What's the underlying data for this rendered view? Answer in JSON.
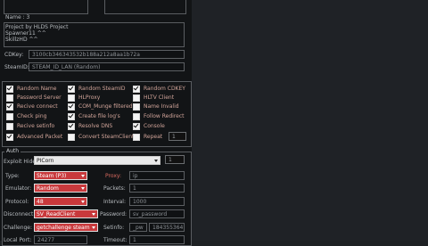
{
  "info": {
    "name_line": "Name : 3",
    "desc_lines": [
      "Project by HLDS Project",
      "Spawner11 ^^",
      "SkillzHD ^^"
    ],
    "cdkey_label": "CDKey:",
    "cdkey_value": "3100cb346343532b188a212a8aa1b72a",
    "steamid_label": "SteamID:",
    "steamid_value": "STEAM_ID_LAN (Random)"
  },
  "options": {
    "col1": [
      {
        "label": "Random Name",
        "checked": true
      },
      {
        "label": "Password Server",
        "checked": false
      },
      {
        "label": "Recive connect",
        "checked": true
      },
      {
        "label": "Check ping",
        "checked": false
      },
      {
        "label": "Recive setinfo",
        "checked": false
      },
      {
        "label": "Advanced Packet",
        "checked": true
      }
    ],
    "col2": [
      {
        "label": "Random SteamID",
        "checked": true
      },
      {
        "label": "HLProxy",
        "checked": false
      },
      {
        "label": "COM_Munge filtered",
        "checked": true
      },
      {
        "label": "Create file log's",
        "checked": true
      },
      {
        "label": "Resolve DNS",
        "checked": true
      },
      {
        "label": "Convert SteamClient",
        "checked": false
      }
    ],
    "col3": [
      {
        "label": "Random CDKEY",
        "checked": true
      },
      {
        "label": "HLTV Client",
        "checked": false
      },
      {
        "label": "Name Invalid",
        "checked": false
      },
      {
        "label": "Follow Redirect",
        "checked": false
      },
      {
        "label": "Console",
        "checked": true
      },
      {
        "label": "Repeat",
        "checked": false
      }
    ],
    "repeat_value": "1"
  },
  "auth": {
    "group_title": "Auth",
    "exploit_label": "Exploit Hide:",
    "exploit_value": "PICorn",
    "exploit_count": "1",
    "type_label": "Type:",
    "type_value": "Steam (P3)",
    "emulator_label": "Emulator:",
    "emulator_value": "Random",
    "protocol_label": "Protocol:",
    "protocol_value": "48",
    "disconnect_label": "Disconnect:",
    "disconnect_value": "SV_ReadClient",
    "challenge_label": "Challenge:",
    "challenge_value": "getchallenge steam",
    "localport_label": "Local Port:",
    "localport_value": "24277",
    "proxy_label": "Proxy:",
    "proxy_value": "ip",
    "packets_label": "Packets:",
    "packets_value": "1",
    "interval_label": "Interval:",
    "interval_value": "1000",
    "password_label": "Password:",
    "password_value": "sv_password",
    "setinfo_label": "Setinfo:",
    "setinfo_key": "_pw",
    "setinfo_value": "184355364",
    "timeout_label": "Timeout:",
    "timeout_value": "1"
  }
}
